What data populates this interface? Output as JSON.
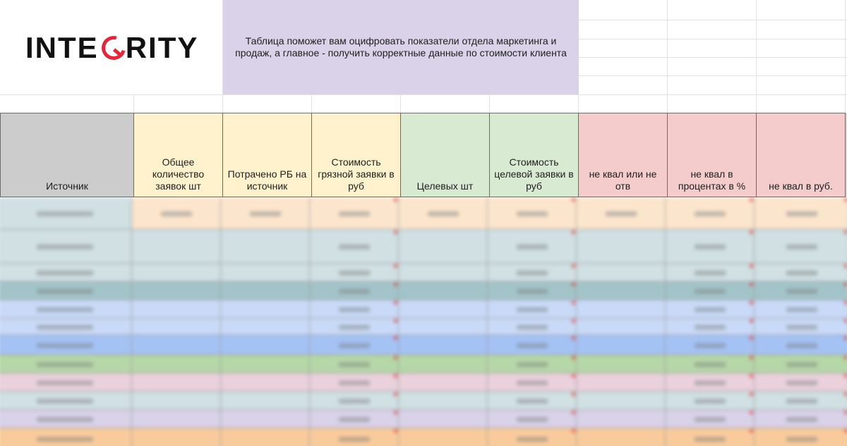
{
  "logo": {
    "letters": [
      "I",
      "N",
      "T",
      "E",
      "",
      "R",
      "I",
      "T",
      "Y"
    ],
    "text": "INTEGRITY"
  },
  "info": {
    "text": "Таблица поможет вам оцифровать показатели отдела маркетинга и продаж, а главное - получить корректные данные по стоимости клиента"
  },
  "table": {
    "headers": [
      "Источник",
      "Общее количество заявок шт",
      "Потрачено РБ на источник",
      "Стоимость грязной заявки в руб",
      "Целевых шт",
      "Стоимость целевой заявки в руб",
      "не квал или не отв",
      "не квал в процентах в %",
      "не квал в руб."
    ],
    "header_colors": [
      "#cccccc",
      "#fff2cc",
      "#fff2cc",
      "#fff2cc",
      "#d9ead3",
      "#d9ead3",
      "#f4cccc",
      "#f4cccc",
      "#f4cccc"
    ]
  },
  "colors": {
    "accent_red": "#e3263a",
    "info_bg": "#d9d2e9"
  }
}
